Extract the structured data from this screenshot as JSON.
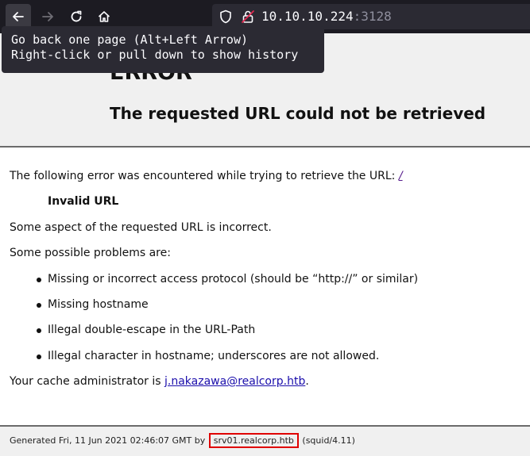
{
  "browser": {
    "url_host": "10.10.10.224",
    "url_port": ":3128",
    "tooltip_line1": "Go back one page (Alt+Left Arrow)",
    "tooltip_line2": "Right-click or pull down to show history"
  },
  "page": {
    "title": "ERROR",
    "subtitle": "The requested URL could not be retrieved",
    "intro_text": "The following error was encountered while trying to retrieve the URL: ",
    "intro_link": "/",
    "error_name": "Invalid URL",
    "description": "Some aspect of the requested URL is incorrect.",
    "problems_heading": "Some possible problems are:",
    "problems": [
      "Missing or incorrect access protocol (should be “http://” or similar)",
      "Missing hostname",
      "Illegal double-escape in the URL-Path",
      "Illegal character in hostname; underscores are not allowed."
    ],
    "admin_prefix": "Your cache administrator is ",
    "admin_email": "j.nakazawa@realcorp.htb",
    "admin_suffix": "."
  },
  "footer": {
    "generated_prefix": "Generated Fri, 11 Jun 2021 02:46:07 GMT by",
    "hostname": "srv01.realcorp.htb",
    "software": "(squid/4.11)"
  },
  "colors": {
    "toolbar_bg": "#1c1b22",
    "highlight_box": "#e00000",
    "link": "#551a8b"
  },
  "icons": [
    "back-arrow-icon",
    "forward-arrow-icon",
    "reload-icon",
    "home-icon",
    "shield-icon",
    "lock-icon"
  ]
}
